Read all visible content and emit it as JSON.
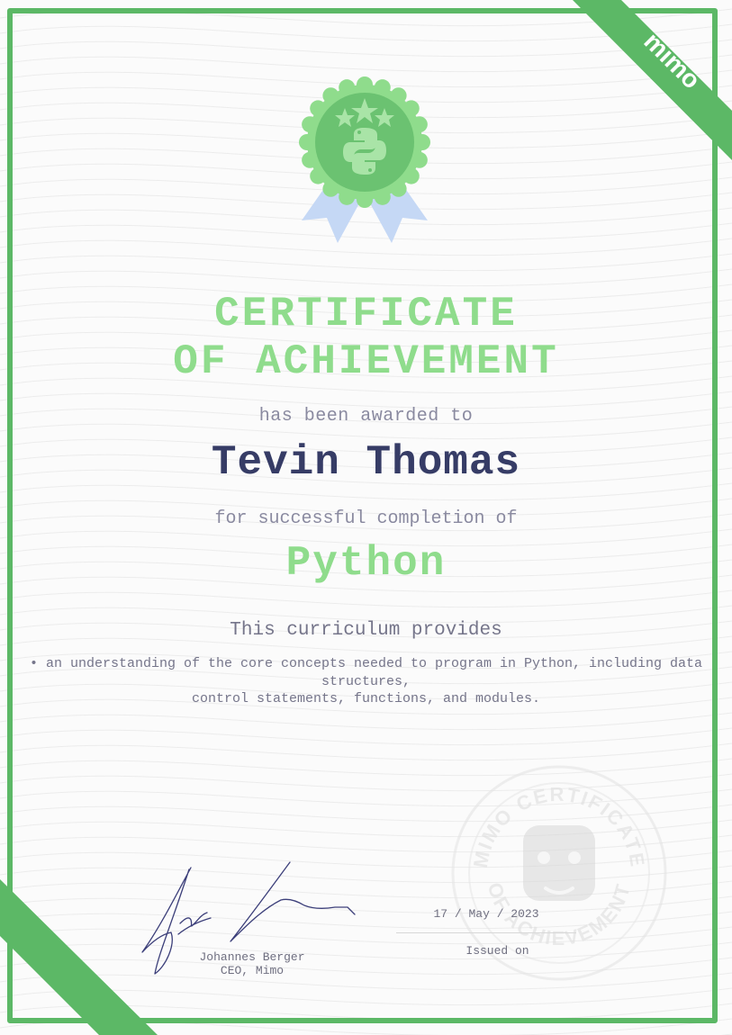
{
  "certificate": {
    "brand": "mimo",
    "title_line1": "CERTIFICATE",
    "title_line2": "OF ACHIEVEMENT",
    "awarded_text": "has been awarded to",
    "recipient_name": "Tevin Thomas",
    "completion_text": "for successful completion of",
    "course_name": "Python",
    "curriculum_intro": "This curriculum provides",
    "curriculum_description": "• an understanding of the core concepts needed to program in Python, including data structures,\ncontrol statements, functions, and modules.",
    "signer_name": "Johannes Berger",
    "signer_title": "CEO, Mimo",
    "issue_date": "17 / May / 2023",
    "issued_label": "Issued on",
    "seal_text_top": "MIMO CERTIFICATE",
    "seal_text_bottom": "OF ACHIEVEMENT"
  },
  "colors": {
    "accent_green": "#8fdc8c",
    "frame_green": "#5cb866",
    "name_navy": "#363c66",
    "text_gray": "#8a8aa0",
    "ribbon_blue": "#c5d8f5"
  },
  "icons": {
    "badge": "python-medal-icon",
    "seal": "mimo-robot-seal-icon",
    "signature": "handwritten-signature"
  }
}
